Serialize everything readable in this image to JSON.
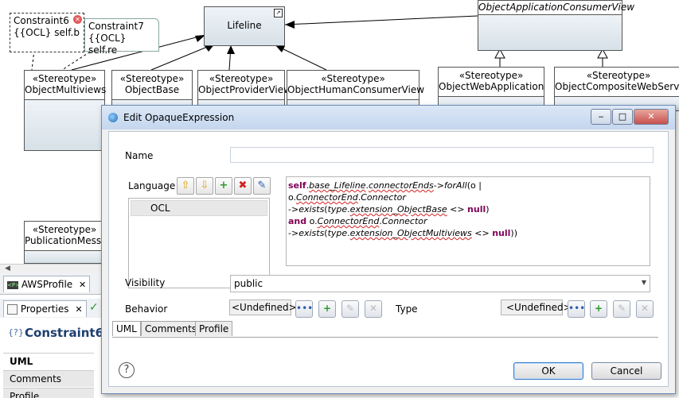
{
  "diagram": {
    "constraint6": {
      "name": "Constraint6",
      "body": "{{OCL} self.b"
    },
    "constraint7": {
      "name": "Constraint7",
      "body": "{{OCL} self.re"
    },
    "lifeline": "Lifeline",
    "object_app_consumer_view": "ObjectApplicationConsumerView",
    "stereotype_label": "«Stereotype»",
    "classes": [
      "ObjectMultiviews",
      "ObjectBase",
      "ObjectProviderView",
      "ObjectHumanConsumerView",
      "ObjectWebApplication",
      "ObjectCompositeWebService",
      "PublicationMessa"
    ]
  },
  "left_panel": {
    "editor_tab": "AWSProfile",
    "properties_tab": "Properties",
    "selected_element": "Constraint6",
    "categories": [
      "UML",
      "Comments",
      "Profile"
    ]
  },
  "dialog": {
    "title": "Edit OpaqueExpression",
    "name_label": "Name",
    "name_value": "",
    "language_label": "Language",
    "languages": [
      "OCL"
    ],
    "body_lines": [
      "self.base_Lifeline.connectorEnds->forAll(o |",
      "o.ConnectorEnd.Connector",
      "->exists(type.extension_ObjectBase <> null)",
      "and o.ConnectorEnd.Connector",
      "->exists(type.extension_ObjectMultiviews <> null))"
    ],
    "visibility_label": "Visibility",
    "visibility_value": "public",
    "behavior_label": "Behavior",
    "behavior_value": "<Undefined>",
    "type_label": "Type",
    "type_value": "<Undefined>",
    "tabs": [
      "UML",
      "Comments",
      "Profile"
    ],
    "ok_label": "OK",
    "cancel_label": "Cancel",
    "help_glyph": "?"
  },
  "colors": {
    "title_bar": "#c4d6ee",
    "class_fill": "#dbe4eb",
    "keyword": "#7f0055",
    "close_button": "#c75050"
  }
}
